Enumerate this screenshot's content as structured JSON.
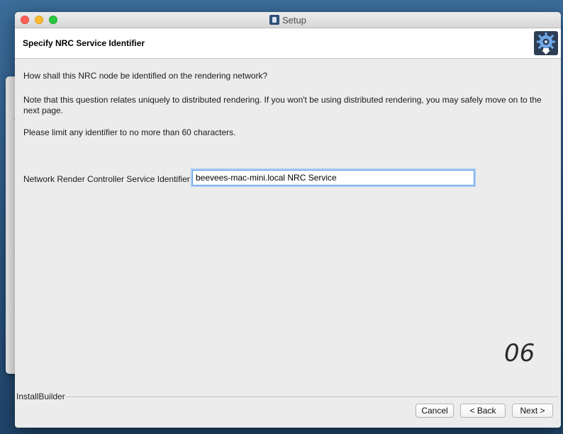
{
  "window": {
    "title": "Setup"
  },
  "header": {
    "title": "Specify NRC Service Identifier",
    "logo_icon": "installer-gear-icon"
  },
  "main": {
    "question": "How shall this NRC node be identified on the rendering network?",
    "note": "Note that this question relates uniquely to distributed rendering.  If you won't be using distributed rendering, you may safely move on to the next page.",
    "limit": "Please limit any identifier to no more than 60 characters.",
    "field": {
      "label": "Network Render Controller Service Identifier",
      "value": "beevees-mac-mini.local NRC Service"
    },
    "page_number": "06"
  },
  "footer": {
    "brand": "InstallBuilder",
    "buttons": {
      "cancel": "Cancel",
      "back": "< Back",
      "next": "Next >"
    }
  },
  "colors": {
    "focus_ring": "#5b9ee9",
    "close": "#fc5f57",
    "minimize": "#fdbc2e",
    "zoom": "#28c840"
  }
}
